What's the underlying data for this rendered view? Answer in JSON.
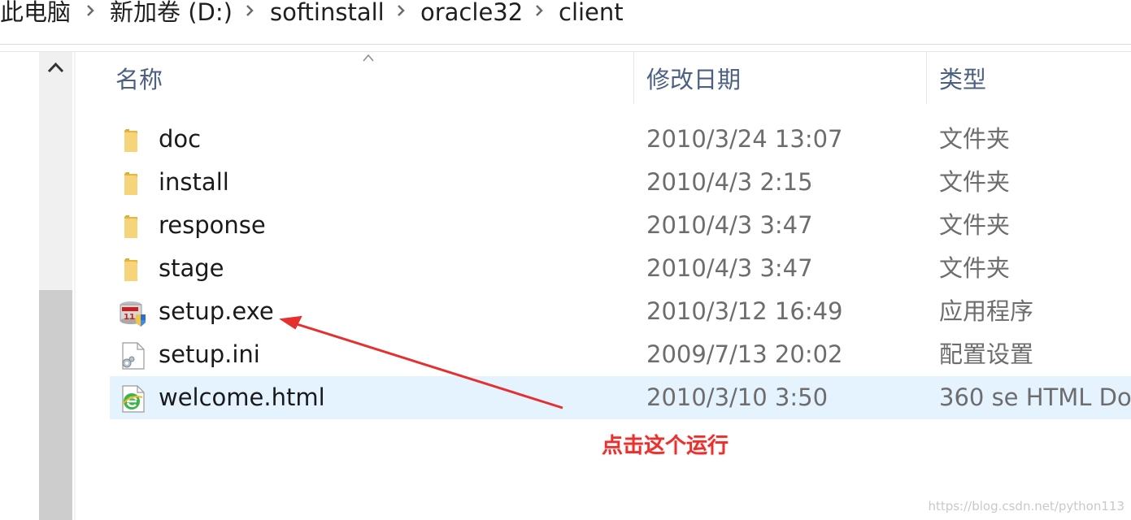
{
  "breadcrumb": [
    "此电脑",
    "新加卷 (D:)",
    "softinstall",
    "oracle32",
    "client"
  ],
  "columns": {
    "name": "名称",
    "modified": "修改日期",
    "type": "类型"
  },
  "files": [
    {
      "name": "doc",
      "modified": "2010/3/24 13:07",
      "type": "文件夹",
      "icon": "folder-icon"
    },
    {
      "name": "install",
      "modified": "2010/4/3 2:15",
      "type": "文件夹",
      "icon": "folder-icon"
    },
    {
      "name": "response",
      "modified": "2010/4/3 3:47",
      "type": "文件夹",
      "icon": "folder-icon"
    },
    {
      "name": "stage",
      "modified": "2010/4/3 3:47",
      "type": "文件夹",
      "icon": "folder-icon"
    },
    {
      "name": "setup.exe",
      "modified": "2010/3/12 16:49",
      "type": "应用程序",
      "icon": "oracle-setup-icon"
    },
    {
      "name": "setup.ini",
      "modified": "2009/7/13 20:02",
      "type": "配置设置",
      "icon": "config-file-icon"
    },
    {
      "name": "welcome.html",
      "modified": "2010/3/10 3:50",
      "type": "360 se HTML Do",
      "icon": "browser-html-icon"
    }
  ],
  "selected_index": 6,
  "annotation": "点击这个运行",
  "watermark": "https://blog.csdn.net/python113",
  "colors": {
    "header_text": "#4d6082",
    "selection": "#e5f3ff",
    "annotation": "#e8312e",
    "folder": "#f2c14e"
  }
}
